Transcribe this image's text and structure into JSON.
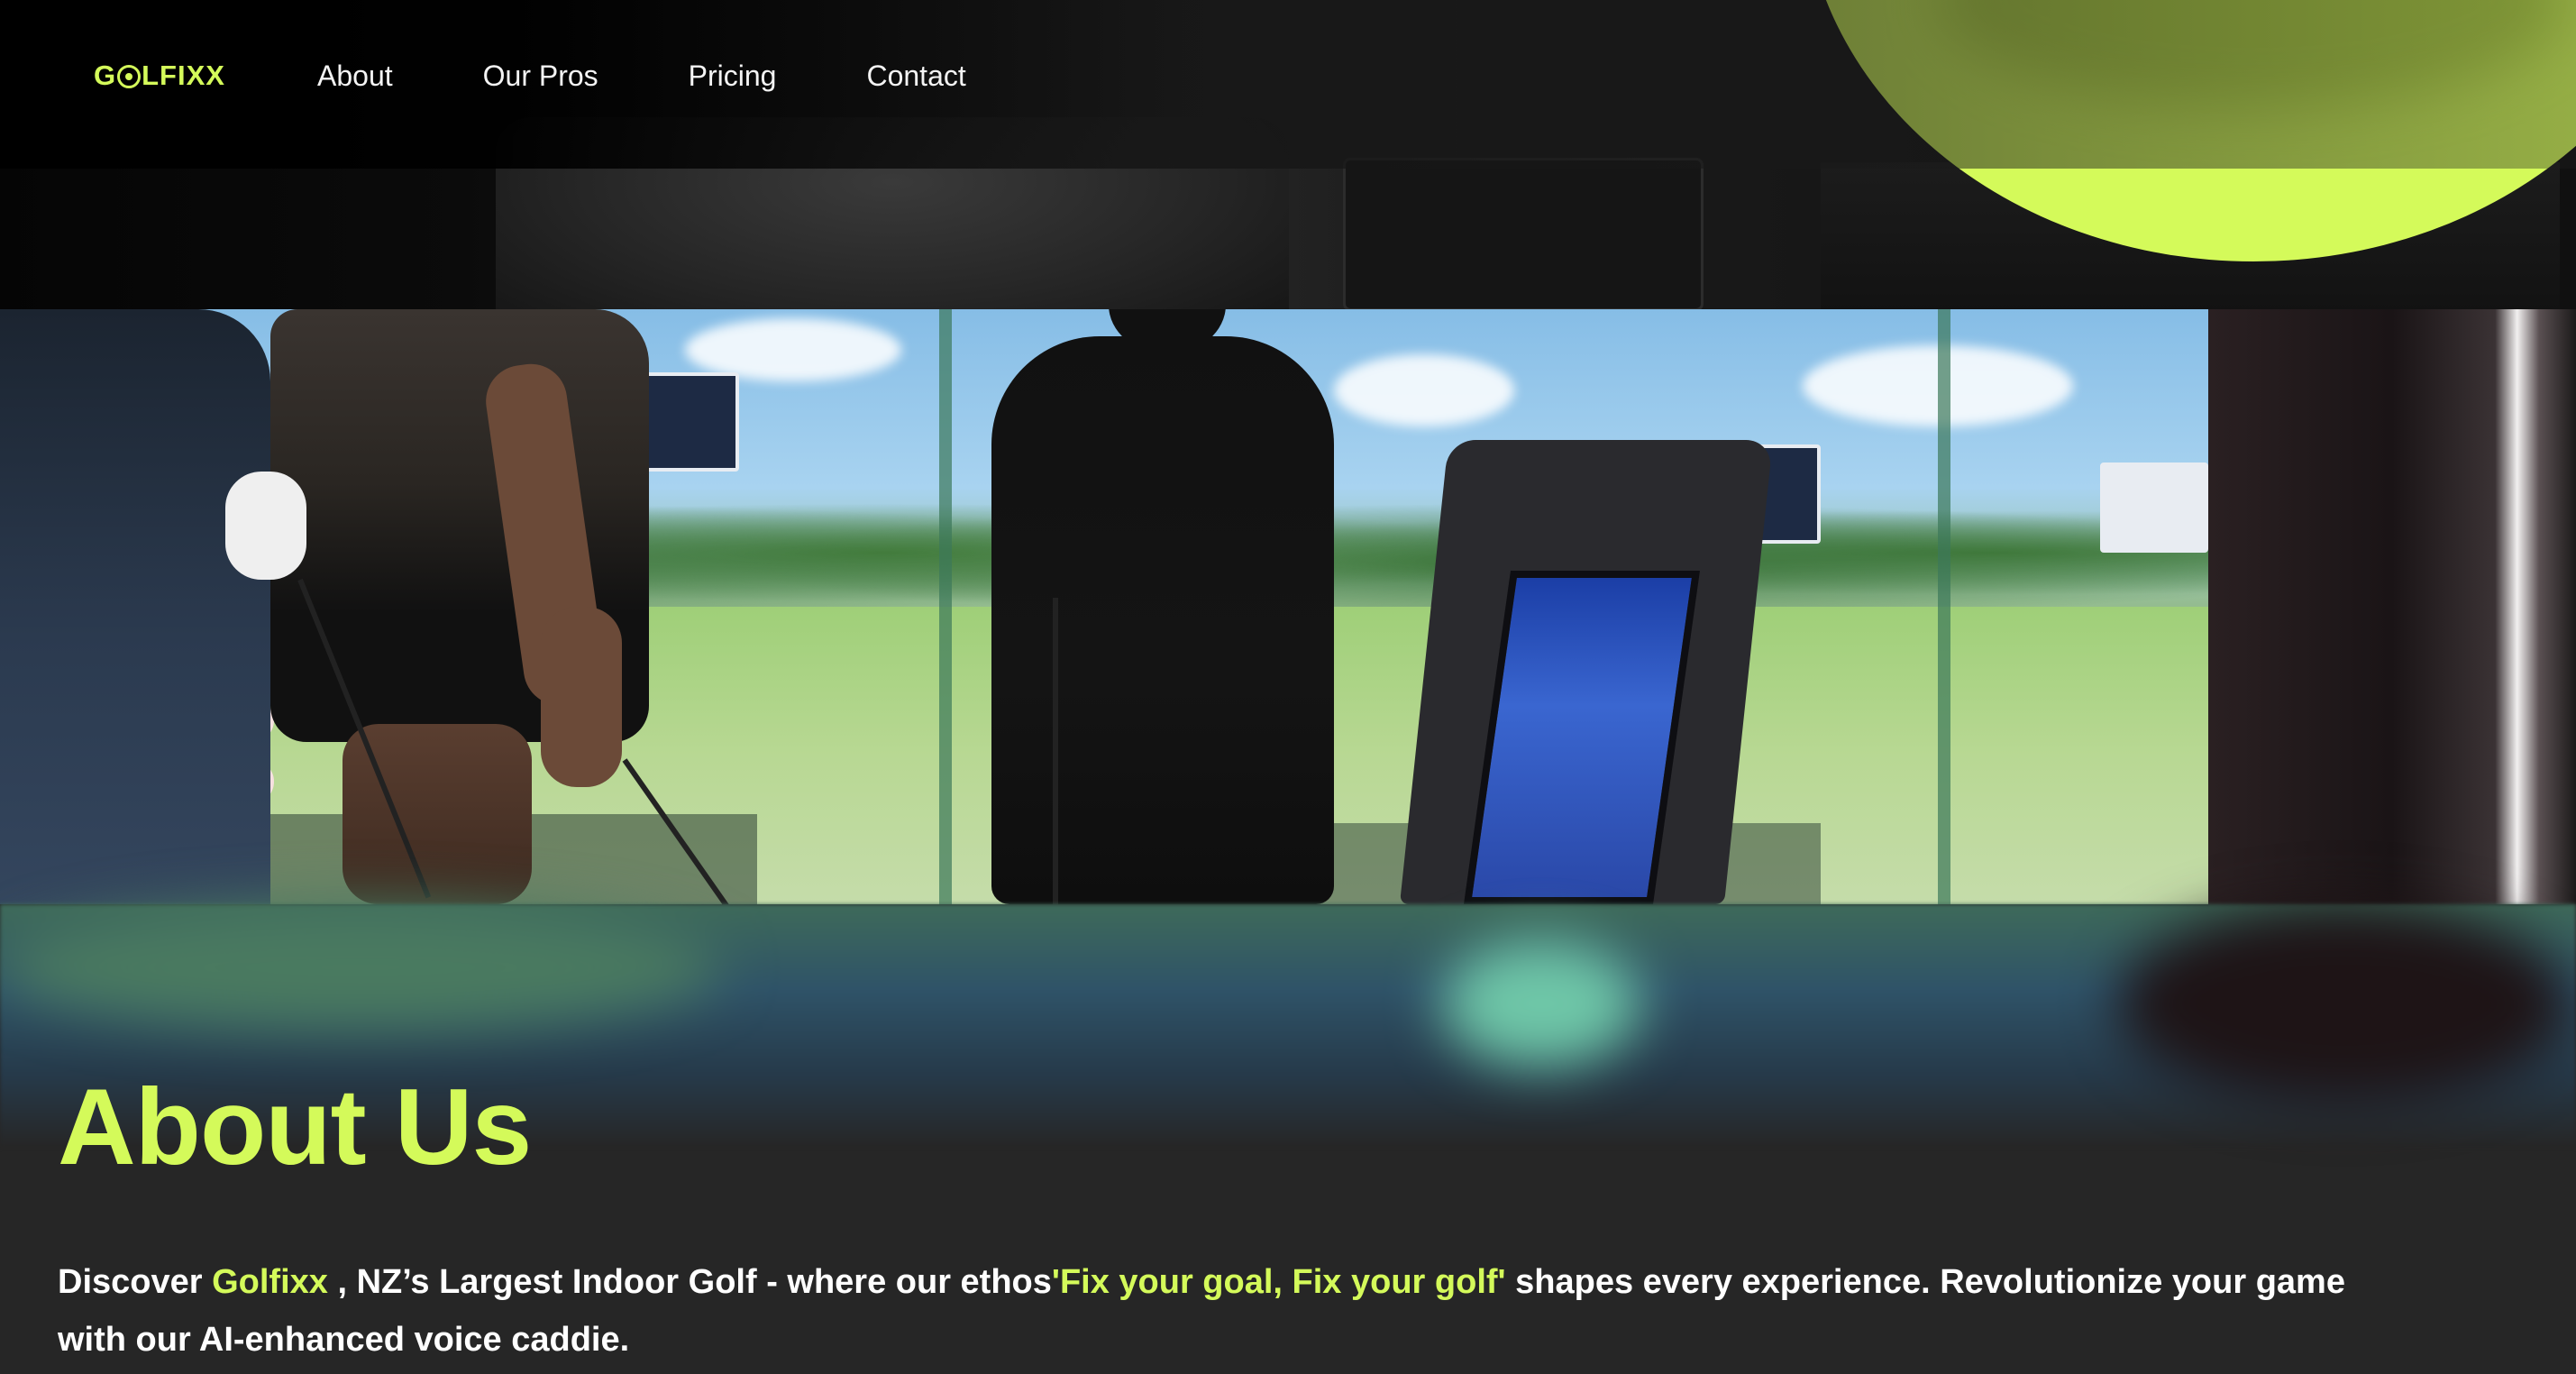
{
  "brand": {
    "logo_text_left": "G",
    "logo_text_right": "LFIXX",
    "accent_color": "#d4fa5a"
  },
  "nav": {
    "items": [
      {
        "label": "About"
      },
      {
        "label": "Our Pros"
      },
      {
        "label": "Pricing"
      },
      {
        "label": "Contact"
      }
    ]
  },
  "about": {
    "title": "About Us",
    "text_1": "Discover ",
    "brand_name": "Golfixx",
    "text_2": " , NZ’s Largest Indoor Golf - where our ethos",
    "ethos": "'Fix your goal, Fix your golf'",
    "text_3": " shapes every experience. Revolutionize your game with our AI-enhanced voice caddie."
  }
}
